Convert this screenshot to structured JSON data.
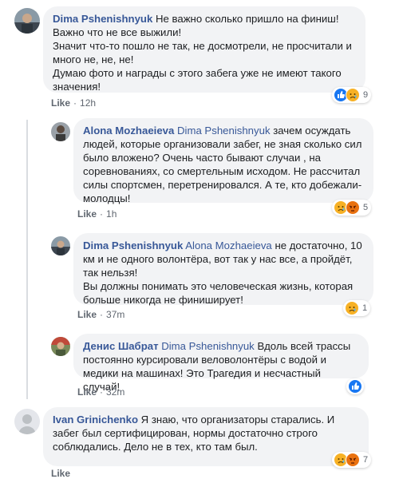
{
  "comments": [
    {
      "author": "Dima Pshenishnyuk",
      "mention": "",
      "text_first": "Не важно сколько пришло на финиш!",
      "text_rest": "Важно что не все выжили!\nЗначит что-то пошло не так, не досмотрели, не просчитали и много не, не, не!\nДумаю фото и награды с этого забега уже не имеют такого значения!",
      "like_label": "Like",
      "time": "12h",
      "reaction_count": "9",
      "reactions": [
        "like",
        "sad"
      ]
    },
    {
      "author": "Alona Mozhaeieva",
      "mention": "Dima Pshenishnyuk",
      "text": "зачем осуждать людей, которые организовали забег, не зная сколько сил было вложено? Очень часто бывают случаи , на соревнованиях, со смертельным исходом. Не рассчитал силы спортсмен, перетренировался. А те, кто добежали- молодцы!",
      "like_label": "Like",
      "time": "1h",
      "reaction_count": "5",
      "reactions": [
        "sad",
        "angry"
      ]
    },
    {
      "author": "Dima Pshenishnyuk",
      "mention": "Alona Mozhaeieva",
      "text": "не достаточно, 10 км и не одного волонтёра, вот так у нас все, а пройдёт, так нельзя!\nВы должны понимать это человеческая жизнь, которая больше никогда не финиширует!",
      "like_label": "Like",
      "time": "37m",
      "reaction_count": "1",
      "reactions": [
        "sad"
      ]
    },
    {
      "author": "Денис Шабрат",
      "mention": "Dima Pshenishnyuk",
      "text": "Вдоль всей трассы постоянно курсировали веловолонтёры с водой и медики на машинах! Это Трагедия и несчастный случай!",
      "like_label": "Like",
      "time": "32m",
      "reaction_count": "",
      "reactions": [
        "like"
      ]
    },
    {
      "author": "Ivan Grinichenko",
      "mention": "",
      "text": "Я знаю, что организаторы старались. И забег был сертифицирован, нормы достаточно строго соблюдались. Дело не в тех, кто там был.",
      "like_label": "Like",
      "time": "",
      "reaction_count": "7",
      "reactions": [
        "sad",
        "angry"
      ]
    }
  ],
  "separator": "·",
  "colors": {
    "author_link": "#385898",
    "bubble_bg": "#f2f3f5",
    "like_blue": "#1877f2",
    "sad_yellow": "#f7b125",
    "angry_orange": "#e9710f",
    "meta_gray": "#606770"
  }
}
